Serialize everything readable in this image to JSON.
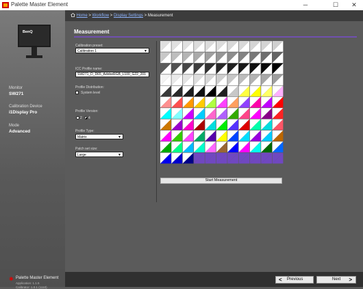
{
  "window": {
    "title": "Palette Master Element",
    "minimize_glyph": "─",
    "maximize_glyph": "☐",
    "close_glyph": "✕"
  },
  "breadcrumb": {
    "items": [
      "Home",
      "Workflow",
      "Display Settings",
      "Measurement"
    ],
    "separator": ">"
  },
  "sidebar": {
    "monitor_label": "Monitor",
    "monitor_value": "SW271",
    "device_label": "Calibration Device",
    "device_value": "i1Display Pro",
    "mode_label": "Mode",
    "mode_value": "Advanced",
    "monitor_brand": "BenQ"
  },
  "brand": {
    "app_name": "Palette Master Element",
    "application_version": "Application: 1.1.5",
    "calibrator_version": "Calibrator: 1.0.1 (1110)"
  },
  "page": {
    "title": "Measurement",
    "calibration_preset_label": "Calibration preset:",
    "calibration_preset_value": "Calibration 1",
    "icc_profile_label": "ICC Profile name:",
    "icc_profile_value": "SW271_D_D65_AdobeRGB_L100_G22_201",
    "profile_distribution_label": "Profile Distribution:",
    "system_level_label": "System level",
    "profile_version_label": "Profile Version:",
    "version_options": [
      "2",
      "4"
    ],
    "version_selected": "4",
    "profile_type_label": "Profile Type:",
    "profile_type_value": "Matrix",
    "patch_set_label": "Patch set size:",
    "patch_set_value": "Large",
    "start_button": "Start Measurement"
  },
  "footer": {
    "previous_label": "Previous",
    "next_label": "Next"
  },
  "colors": {
    "accent": "#7050b0",
    "patch_purple": "#7048c0"
  },
  "patches": {
    "rows": [
      [
        [
          "#e0e0e0",
          "#ffffff"
        ],
        [
          "#e0e0e0",
          "#ffffff"
        ],
        [
          "#e0e0e0",
          "#ffffff"
        ],
        [
          "#dcdcdc",
          "#ffffff"
        ],
        [
          "#dcdcdc",
          "#ffffff"
        ],
        [
          "#dcdcdc",
          "#ffffff"
        ],
        [
          "#d8d8d8",
          "#ffffff"
        ],
        [
          "#d8d8d8",
          "#ffffff"
        ],
        [
          "#d4d4d4",
          "#ffffff"
        ],
        [
          "#d4d4d4",
          "#ffffff"
        ],
        [
          "#d0d0d0",
          "#ffffff"
        ]
      ],
      [
        [
          "#c8c8c8",
          "#ffffff"
        ],
        [
          "#bebebe",
          "#ffffff"
        ],
        [
          "#b4b4b4",
          "#ffffff"
        ],
        [
          "#aaaaaa",
          "#ffffff"
        ],
        [
          "#a0a0a0",
          "#ffffff"
        ],
        [
          "#969696",
          "#ffffff"
        ],
        [
          "#8c8c8c",
          "#ffffff"
        ],
        [
          "#828282",
          "#ffffff"
        ],
        [
          "#787878",
          "#ffffff"
        ],
        [
          "#6e6e6e",
          "#ffffff"
        ],
        [
          "#646464",
          "#ffffff"
        ]
      ],
      [
        [
          "#5a5a5a",
          "#ffffff"
        ],
        [
          "#505050",
          "#ffffff"
        ],
        [
          "#464646",
          "#ffffff"
        ],
        [
          "#3c3c3c",
          "#ffffff"
        ],
        [
          "#323232",
          "#ffffff"
        ],
        [
          "#282828",
          "#ffffff"
        ],
        [
          "#202020",
          "#ffffff"
        ],
        [
          "#181818",
          "#ffffff"
        ],
        [
          "#101010",
          "#ffffff"
        ],
        [
          "#080808",
          "#ffffff"
        ],
        [
          "#000000",
          "#ffffff"
        ]
      ],
      [
        [
          "#f4f4f4",
          "#ffffff"
        ],
        [
          "#eaeaea",
          "#ffffff"
        ],
        [
          "#e4e4e4",
          "#ffffff"
        ],
        [
          "#dedede",
          "#ffffff"
        ],
        [
          "#d6d6d6",
          "#ffffff"
        ],
        [
          "#cecece",
          "#ffffff"
        ],
        [
          "#c6c6c6",
          "#ffffff"
        ],
        [
          "#bcbcbc",
          "#ffffff"
        ],
        [
          "#b2b2b2",
          "#ffffff"
        ],
        [
          "#a8a8a8",
          "#ffffff"
        ],
        [
          "#9e9e9e",
          "#ffffff"
        ]
      ],
      [
        [
          "#ffffff",
          "#3a3a3a"
        ],
        [
          "#ffffff",
          "#2a2a2a"
        ],
        [
          "#ffffff",
          "#1c1c1c"
        ],
        [
          "#ffffff",
          "#101010"
        ],
        [
          "#ffffff",
          "#000000"
        ],
        [
          "#ffffff",
          "#202020"
        ],
        [
          "#ffffff",
          "#c8c8c8"
        ],
        [
          "#ffffff",
          "#ffff40"
        ],
        [
          "#ffffff",
          "#ffff00"
        ],
        [
          "#ffffff",
          "#ffff66"
        ],
        [
          "#ffffff",
          "#ffb0ff"
        ]
      ],
      [
        [
          "#ffffff",
          "#ff9090"
        ],
        [
          "#ffffff",
          "#ff5050"
        ],
        [
          "#ffffff",
          "#ff9900"
        ],
        [
          "#ffffff",
          "#ffcc00"
        ],
        [
          "#ffffff",
          "#b0ff40"
        ],
        [
          "#ffffff",
          "#ff40ff"
        ],
        [
          "#ffffff",
          "#ffa060"
        ],
        [
          "#ffffff",
          "#9040ff"
        ],
        [
          "#ffffff",
          "#ff00aa"
        ],
        [
          "#ffffff",
          "#c000ff"
        ],
        [
          "#ffffff",
          "#ff0000"
        ]
      ],
      [
        [
          "#ffffff",
          "#00ffff"
        ],
        [
          "#ffffff",
          "#80ffff"
        ],
        [
          "#ffffff",
          "#cc00ff"
        ],
        [
          "#ffffff",
          "#00ccff"
        ],
        [
          "#ffffff",
          "#ff66cc"
        ],
        [
          "#ffffff",
          "#b060ff"
        ],
        [
          "#ffffff",
          "#33aa00"
        ],
        [
          "#ffffff",
          "#ff4488"
        ],
        [
          "#ffffff",
          "#ff00ff"
        ],
        [
          "#ffffff",
          "#880088"
        ],
        [
          "#ffffff",
          "#ff2222"
        ]
      ],
      [
        [
          "#ffffff",
          "#cc7700"
        ],
        [
          "#ffffff",
          "#9900cc"
        ],
        [
          "#ffffff",
          "#ff00cc"
        ],
        [
          "#ffffff",
          "#aa0000"
        ],
        [
          "#ffffff",
          "#00dddd"
        ],
        [
          "#ffffff",
          "#00ee00"
        ],
        [
          "#ffffff",
          "#5533ff"
        ],
        [
          "#ffffff",
          "#dd0000"
        ],
        [
          "#ffffff",
          "#00ffaa"
        ],
        [
          "#ffffff",
          "#00dddd"
        ],
        [
          "#ffffff",
          "#ff5566"
        ]
      ],
      [
        [
          "#ffffff",
          "#ff00ff"
        ],
        [
          "#ffffff",
          "#33cc00"
        ],
        [
          "#ffffff",
          "#ff44ff"
        ],
        [
          "#ffffff",
          "#00aa66"
        ],
        [
          "#ffffff",
          "#5500aa"
        ],
        [
          "#ffffff",
          "#ffff00"
        ],
        [
          "#ffffff",
          "#0044ff"
        ],
        [
          "#ffffff",
          "#00ddff"
        ],
        [
          "#ffffff",
          "#9900dd"
        ],
        [
          "#ffffff",
          "#00ccff"
        ],
        [
          "#ffffff",
          "#bb6600"
        ]
      ],
      [
        [
          "#ffffff",
          "#00aa00"
        ],
        [
          "#ffffff",
          "#00ff88"
        ],
        [
          "#ffffff",
          "#00bbff"
        ],
        [
          "#ffffff",
          "#00ffcc"
        ],
        [
          "#ffffff",
          "#ff66ff"
        ],
        [
          "#ffffff",
          "#996633"
        ],
        [
          "#ffffff",
          "#0000ff"
        ],
        [
          "#ffffff",
          "#ff00ff"
        ],
        [
          "#ffffff",
          "#00ffee"
        ],
        [
          "#ffffff",
          "#006600"
        ],
        [
          "#ffffff",
          "#0066ff"
        ]
      ],
      [
        [
          "#ffffff",
          "#0000ee"
        ],
        [
          "#ffffff",
          "#0000cc"
        ],
        [
          "#ffffff",
          "#000088"
        ],
        [
          "#7048c0",
          "#7048c0"
        ],
        [
          "#7048c0",
          "#7048c0"
        ],
        [
          "#7048c0",
          "#7048c0"
        ],
        [
          "#7048c0",
          "#7048c0"
        ],
        [
          "#7048c0",
          "#7048c0"
        ],
        [
          "#7048c0",
          "#7048c0"
        ],
        [
          "#7048c0",
          "#7048c0"
        ],
        [
          "#7048c0",
          "#7048c0"
        ]
      ]
    ]
  }
}
